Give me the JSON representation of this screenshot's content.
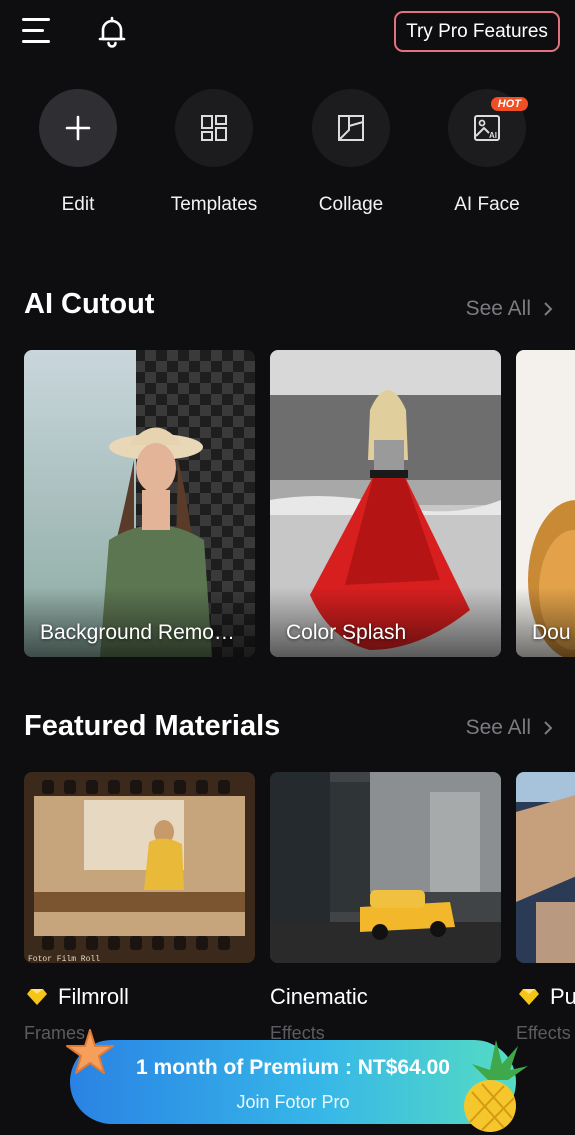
{
  "header": {
    "pro_button_label": "Try Pro Features",
    "pro_border_color": "#e5707f"
  },
  "quick_actions": [
    {
      "label": "Edit",
      "icon": "plus-icon"
    },
    {
      "label": "Templates",
      "icon": "templates-grid-icon"
    },
    {
      "label": "Collage",
      "icon": "collage-icon"
    },
    {
      "label": "AI Face",
      "icon": "ai-image-icon",
      "badge": "HOT"
    }
  ],
  "ai_cutout": {
    "title": "AI Cutout",
    "see_all": "See All",
    "cards": [
      {
        "caption": "Background Remo…"
      },
      {
        "caption": "Color Splash"
      },
      {
        "caption": "Dou"
      }
    ]
  },
  "featured": {
    "title": "Featured Materials",
    "see_all": "See All",
    "items": [
      {
        "title": "Filmroll",
        "subtitle": "Frames",
        "premium": true,
        "film_watermark": "Fotor Film Roll"
      },
      {
        "title": "Cinematic",
        "subtitle": "Effects",
        "premium": false
      },
      {
        "title": "Pu",
        "subtitle": "Effects",
        "premium": true
      }
    ]
  },
  "promo": {
    "line1": "1 month of Premium : NT$64.00",
    "line2": "Join Fotor Pro"
  },
  "colors": {
    "background": "#0e0e10",
    "muted_text": "#7b7b80",
    "premium_diamond": "#f5c518",
    "hot_badge": "#f04e23"
  }
}
